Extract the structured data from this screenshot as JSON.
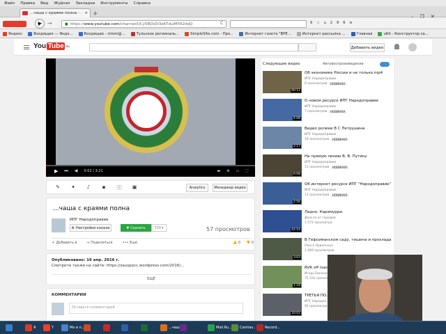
{
  "menubar": [
    "Файл",
    "Правка",
    "Вид",
    "Журнал",
    "Закладки",
    "Инструменты",
    "Справка"
  ],
  "tab": {
    "title": "...чаша с краями полна - ...",
    "close": "×"
  },
  "newtab": "+",
  "window": {
    "minimize": "–",
    "maximize": "❐",
    "close": "✕"
  },
  "nav": {
    "back": "←",
    "forward": "→",
    "url_prefix": "https://",
    "url_domain": "www.youtube.com",
    "url_rest": "/channel/UCy5BDsDi3eKTduIMYA2dqQ",
    "reload": "C",
    "counters": [
      "9",
      "2",
      "9",
      "6"
    ]
  },
  "bookmarks": [
    "Яндекс",
    "Входящие — Янде...",
    "Входящие - mlvm@...",
    "Тульское региональ...",
    "SimpleSite.com - Про...",
    "Интернет газета \"ВРЕ...",
    "Интернет рассылка ...",
    "Главная",
    "uKit - Конструктор са..."
  ],
  "youtube": {
    "logo_you": "You",
    "logo_tube": "Tube",
    "logo_sup": "RU",
    "add_video": "Добавить видео",
    "player": {
      "time": "0:02 / 3:21",
      "progress": 0.01
    },
    "owner_tools": {
      "analytics": "Analytics",
      "manager": "Менеджер видео"
    },
    "video_title": "...чаша с краями полна",
    "channel": "ИПГ Народоправие",
    "settings_btn": "Настройки канала",
    "subscribe": "Скачать",
    "sub_count": "720",
    "views": "57 просмотров",
    "actions": {
      "add": "Добавить в",
      "share": "Поделиться",
      "more": "Ещё",
      "likes": "0",
      "dislikes": "0"
    },
    "published": "Опубликовано: 16 апр. 2016 г.",
    "desc": "Смотрите также на сайте: https://zausросс.wordpress.com/2016/...",
    "more_label": "ЕЩЁ",
    "comments_label": "КОММЕНТАРИИ",
    "comment_placeholder": "Оставьте комментарий"
  },
  "sidebar": {
    "next_label": "Следующее видео",
    "autoplay_label": "Автовоспроизведение",
    "items": [
      {
        "title": "Об экономике России и не только.mp4",
        "channel": "ИПГ Народоправие",
        "views": "6 просмотров",
        "badge": "НОВИНКА",
        "duration": "40:11",
        "color": "#6f6448"
      },
      {
        "title": "О новом ресурсе ИПГ Народоправие",
        "channel": "ИПГ Народоправие",
        "views": "7 просмотров",
        "badge": "НОВИНКА",
        "duration": "4:08",
        "color": "#4469a3"
      },
      {
        "title": "Видео ролики В С Петрушина",
        "channel": "ИПГ Народоправие",
        "views": "19 просмотров",
        "badge": "НОВИНКА",
        "duration": "2:17",
        "color": "#6c86a8"
      },
      {
        "title": "На прямую линию В. В. Путину",
        "channel": "ИПГ Народоправие",
        "views": "11 просмотров",
        "badge": "НОВИНКА",
        "duration": "6:08",
        "color": "#4c4434"
      },
      {
        "title": "Об интернет ресурсе ИПГ \"Народоправие\"",
        "channel": "ИПГ Народоправие",
        "views": "11 просмотров",
        "badge": "НОВИНКА",
        "duration": "2:56",
        "color": "#3a5f96"
      },
      {
        "title": "Ладно. Карамурри.",
        "channel": "Дельта от городов",
        "views": "1 572 просмотра",
        "badge": "",
        "duration": "42:54",
        "color": "#2e4f92"
      },
      {
        "title": "В Гефсиманском саду, тишина и прохлада",
        "channel": "Ольга Нувалчнух",
        "views": "1 069 просмотров",
        "badge": "",
        "duration": "3:03",
        "color": "#4e5a46"
      },
      {
        "title": "RVR off road...",
        "channel": "Игорь Евгенич",
        "views": "75 222 просмотра",
        "badge": "",
        "duration": "1:18",
        "color": "#72905a"
      },
      {
        "title": "ТРЕТЬЯ ПО...",
        "channel": "ИПГ Народоп...",
        "views": "92 просмотра",
        "badge": "",
        "duration": "10:02",
        "color": "#5c6068"
      }
    ]
  },
  "taskbar": [
    {
      "label": "",
      "color": "#3b7fc4"
    },
    {
      "label": "Я",
      "color": "#d23b2c"
    },
    {
      "label": "Y",
      "color": "#e7402f"
    },
    {
      "label": "Мо в п...",
      "color": "#4a84c6"
    },
    {
      "label": "",
      "color": "#d24726"
    },
    {
      "label": "",
      "color": "#c4282a"
    },
    {
      "label": "",
      "color": "#2f5fa6"
    },
    {
      "label": "",
      "color": "#1b6b36"
    },
    {
      "label": "...чаша...",
      "color": "#e06c1b"
    },
    {
      "label": "",
      "color": "#6a2a8a"
    },
    {
      "label": "Mail.Ru...",
      "color": "#2aa04a"
    },
    {
      "label": "Camtas...",
      "color": "#5a8a3c"
    },
    {
      "label": "Record...",
      "color": "#b82626"
    }
  ]
}
